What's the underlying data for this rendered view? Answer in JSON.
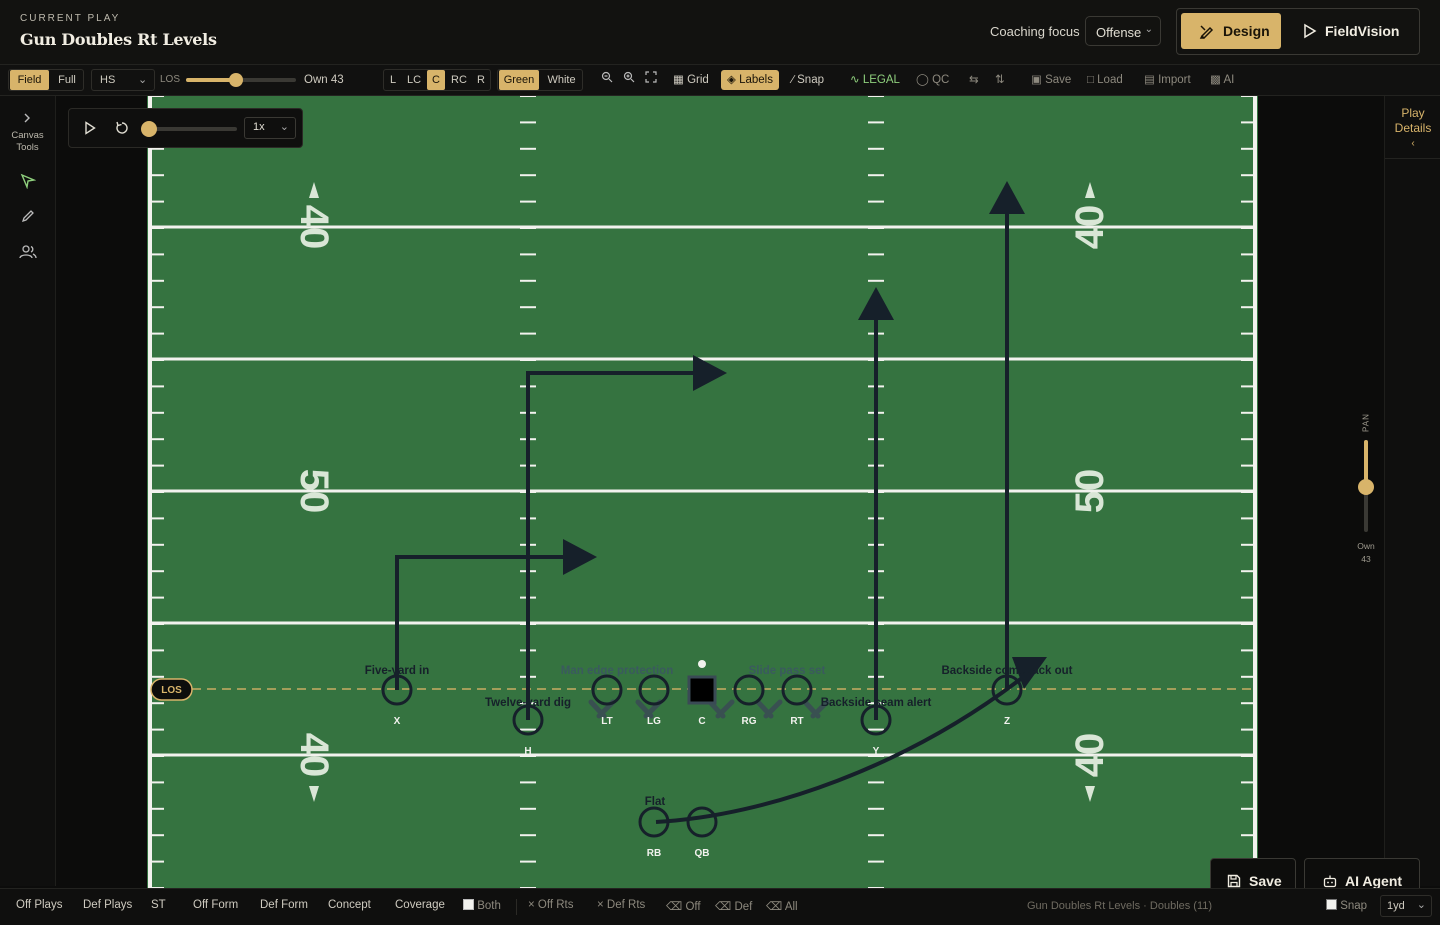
{
  "header": {
    "eyebrow": "CURRENT PLAY",
    "title": "Gun Doubles Rt Levels",
    "coaching_focus_label": "Coaching focus",
    "coaching_focus_value": "Offense",
    "design_label": "Design",
    "fieldvision_label": "FieldVision"
  },
  "toolbar": {
    "view_options": [
      "Field",
      "Full"
    ],
    "view_selected": "Field",
    "level": "HS",
    "los_label": "LOS",
    "los_value": "Own 43",
    "los_slider_fraction": 0.45,
    "hash_options": [
      "L",
      "LC",
      "C",
      "RC",
      "R"
    ],
    "hash_selected": "C",
    "color_options": [
      "Green",
      "White"
    ],
    "color_selected": "Green",
    "grid_label": "Grid",
    "labels_label": "Labels",
    "snap_label": "Snap",
    "legal_label": "LEGAL",
    "qc_label": "QC",
    "save_label": "Save",
    "load_label": "Load",
    "import_label": "Import",
    "ai_label": "AI"
  },
  "left_rail": {
    "canvas_tools_label": "Canvas\nTools"
  },
  "right_rail": {
    "play_details_label": "Play\nDetails",
    "pan_label": "PAN",
    "pan_value": "Own\n43"
  },
  "playback": {
    "speed": "1x",
    "progress_fraction": 0.0
  },
  "field": {
    "yard_numbers": [
      "40",
      "50",
      "40"
    ],
    "los_badge": "LOS",
    "colors": {
      "turf": "#357340",
      "lines": "#f2f2ee",
      "routes": "#16202a",
      "los_line": "#d8b46a",
      "los_badge": "#d8b46a"
    },
    "players": [
      {
        "id": "X",
        "label": "X"
      },
      {
        "id": "H",
        "label": "H"
      },
      {
        "id": "LT",
        "label": "LT"
      },
      {
        "id": "LG",
        "label": "LG"
      },
      {
        "id": "C",
        "label": "C"
      },
      {
        "id": "RG",
        "label": "RG"
      },
      {
        "id": "RT",
        "label": "RT"
      },
      {
        "id": "Y",
        "label": "Y"
      },
      {
        "id": "Z",
        "label": "Z"
      },
      {
        "id": "RB",
        "label": "RB"
      },
      {
        "id": "QB",
        "label": "QB"
      }
    ],
    "route_notes": {
      "x": "Five-yard in",
      "h": "Twelve-yard dig",
      "line_left": "Man edge protection",
      "line_right": "Slide pass set",
      "y": "Backside seam alert",
      "z": "Backside comeback out",
      "rb": "Flat"
    }
  },
  "bottom": {
    "tabs": [
      "Off Plays",
      "Def Plays",
      "ST",
      "Off Form",
      "Def Form",
      "Concept",
      "Coverage"
    ],
    "both_label": "Both",
    "clear_actions": [
      "Off Rts",
      "Def Rts",
      "Off",
      "Def",
      "All"
    ],
    "meta": "Gun Doubles Rt Levels · Doubles (11)",
    "snap_label": "Snap",
    "unit": "1yd"
  },
  "floating": {
    "save_label": "Save",
    "ai_agent_label": "AI Agent"
  }
}
